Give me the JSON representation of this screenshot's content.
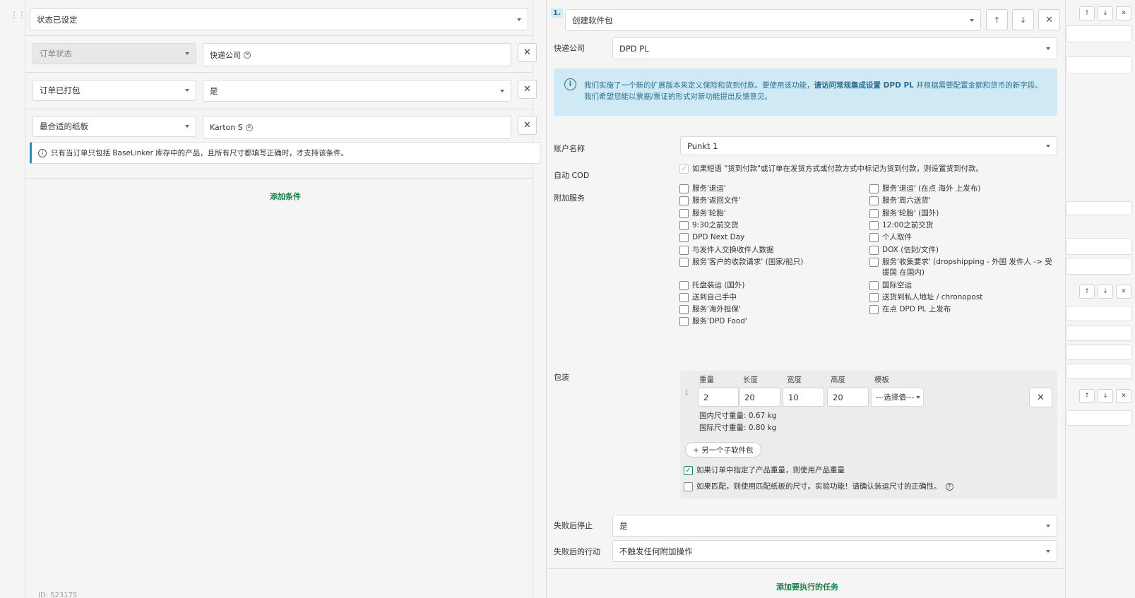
{
  "left": {
    "main_condition_select": "状态已设定",
    "rows": [
      {
        "field": "订单状态",
        "value_tag": "快递公司"
      },
      {
        "field": "订单已打包",
        "value": "是"
      },
      {
        "field": "最合适的纸板",
        "value_tag": "Karton S"
      }
    ],
    "info_note": "只有当订单只包括 BaseLinker 库存中的产品，且所有尺寸都填写正确时，才支持该条件。",
    "add_condition": "添加条件",
    "id_label": "ID: 523175"
  },
  "task": {
    "number": "1.",
    "action_select": "创建软件包",
    "courier_label": "快递公司",
    "courier_value": "DPD PL",
    "info_line1_a": "我们实施了一个新的扩展版本来定义保险和货到付款。要使用该功能，",
    "info_line1_link": "请访问常规集成设置 DPD PL",
    "info_line1_b": " 并根据需要配置金额和货币的新字段。",
    "info_line2": "我们希望您能以票据/票证的形式对新功能提出反馈意见。",
    "account_label": "账户名称",
    "account_value": "Punkt 1",
    "auto_cod_label": "自动 COD",
    "auto_cod_text": "如果短语 \"货到付款\"或订单在发货方式或付款方式中标记为货到付款，则设置货到付款。",
    "extra_services_label": "附加服务",
    "services_left": [
      "服务'退运'",
      "服务'返回文件'",
      "服务'轮胎'",
      "9:30之前交货",
      "DPD Next Day",
      "与发件人交换收件人数据",
      "服务'客户的收款请求' (国家/船只)",
      "托盘装运 (国外)",
      "送到自己手中",
      "服务'海外担保'",
      "服务'DPD Food'"
    ],
    "services_right": [
      "服务'退运' (在点 海外 上发布)",
      "服务'周六送货'",
      "服务'轮胎' (国外)",
      "12:00之前交货",
      "个人取件",
      "DOX (信封/文件)",
      "服务'收集要求' (dropshipping - 外国 发件人 -> 受援国 在国内)",
      "国际空运",
      "送货到私人地址 / chronopost",
      "在点 DPD PL 上发布"
    ],
    "package_label": "包装",
    "package": {
      "row_no": "1",
      "headers": [
        "重量",
        "长度",
        "宽度",
        "高度",
        "模板"
      ],
      "weight": "2",
      "length": "20",
      "width": "10",
      "height": "20",
      "template": "---选择值---",
      "dom_weight": "国内尺寸重量: 0.67 kg",
      "intl_weight": "国际尺寸重量: 0.80 kg",
      "add_subpackage": "+ 另一个子软件包",
      "opt1": "如果订单中指定了产品重量，则使用产品重量",
      "opt2": "如果匹配，则使用匹配纸板的尺寸。实验功能！请确认装运尺寸的正确性。"
    },
    "stop_on_fail_label": "失败后停止",
    "stop_on_fail_value": "是",
    "after_fail_label": "失败后的行动",
    "after_fail_value": "不触发任何附加操作",
    "add_task": "添加要执行的任务"
  },
  "colors": {
    "accent": "#1a7f4b",
    "info_bg": "#cfeaf5",
    "info_text": "#2a6f93"
  }
}
